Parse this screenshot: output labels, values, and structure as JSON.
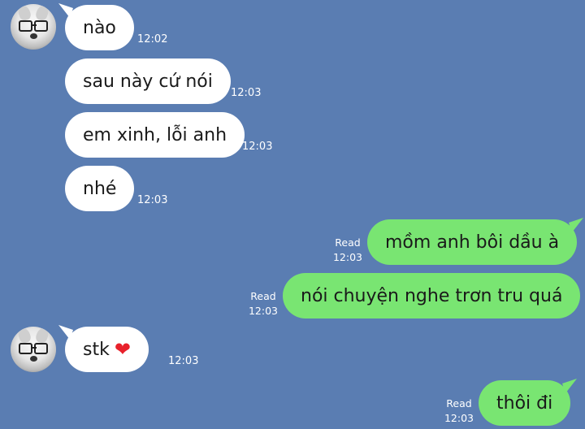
{
  "messages": [
    {
      "text": "nào",
      "time": "12:02"
    },
    {
      "text": "sau này cứ nói",
      "time": "12:03"
    },
    {
      "text": "em xinh, lỗi anh",
      "time": "12:03"
    },
    {
      "text": "nhé",
      "time": "12:03"
    },
    {
      "text": "mồm anh bôi dầu à",
      "time": "12:03",
      "status": "Read"
    },
    {
      "text": "nói chuyện nghe trơn tru quá",
      "time": "12:03",
      "status": "Read"
    },
    {
      "text": "stk",
      "emoji": "❤",
      "time": "12:03"
    },
    {
      "text": "thôi đi",
      "time": "12:03",
      "status": "Read"
    }
  ],
  "colors": {
    "background": "#5a7db2",
    "incoming_bubble": "#ffffff",
    "outgoing_bubble": "#79e572",
    "heart": "#e8212b"
  },
  "icons": {
    "avatar": "husky-avatar-with-glasses",
    "heart": "red-heart-emoji"
  }
}
